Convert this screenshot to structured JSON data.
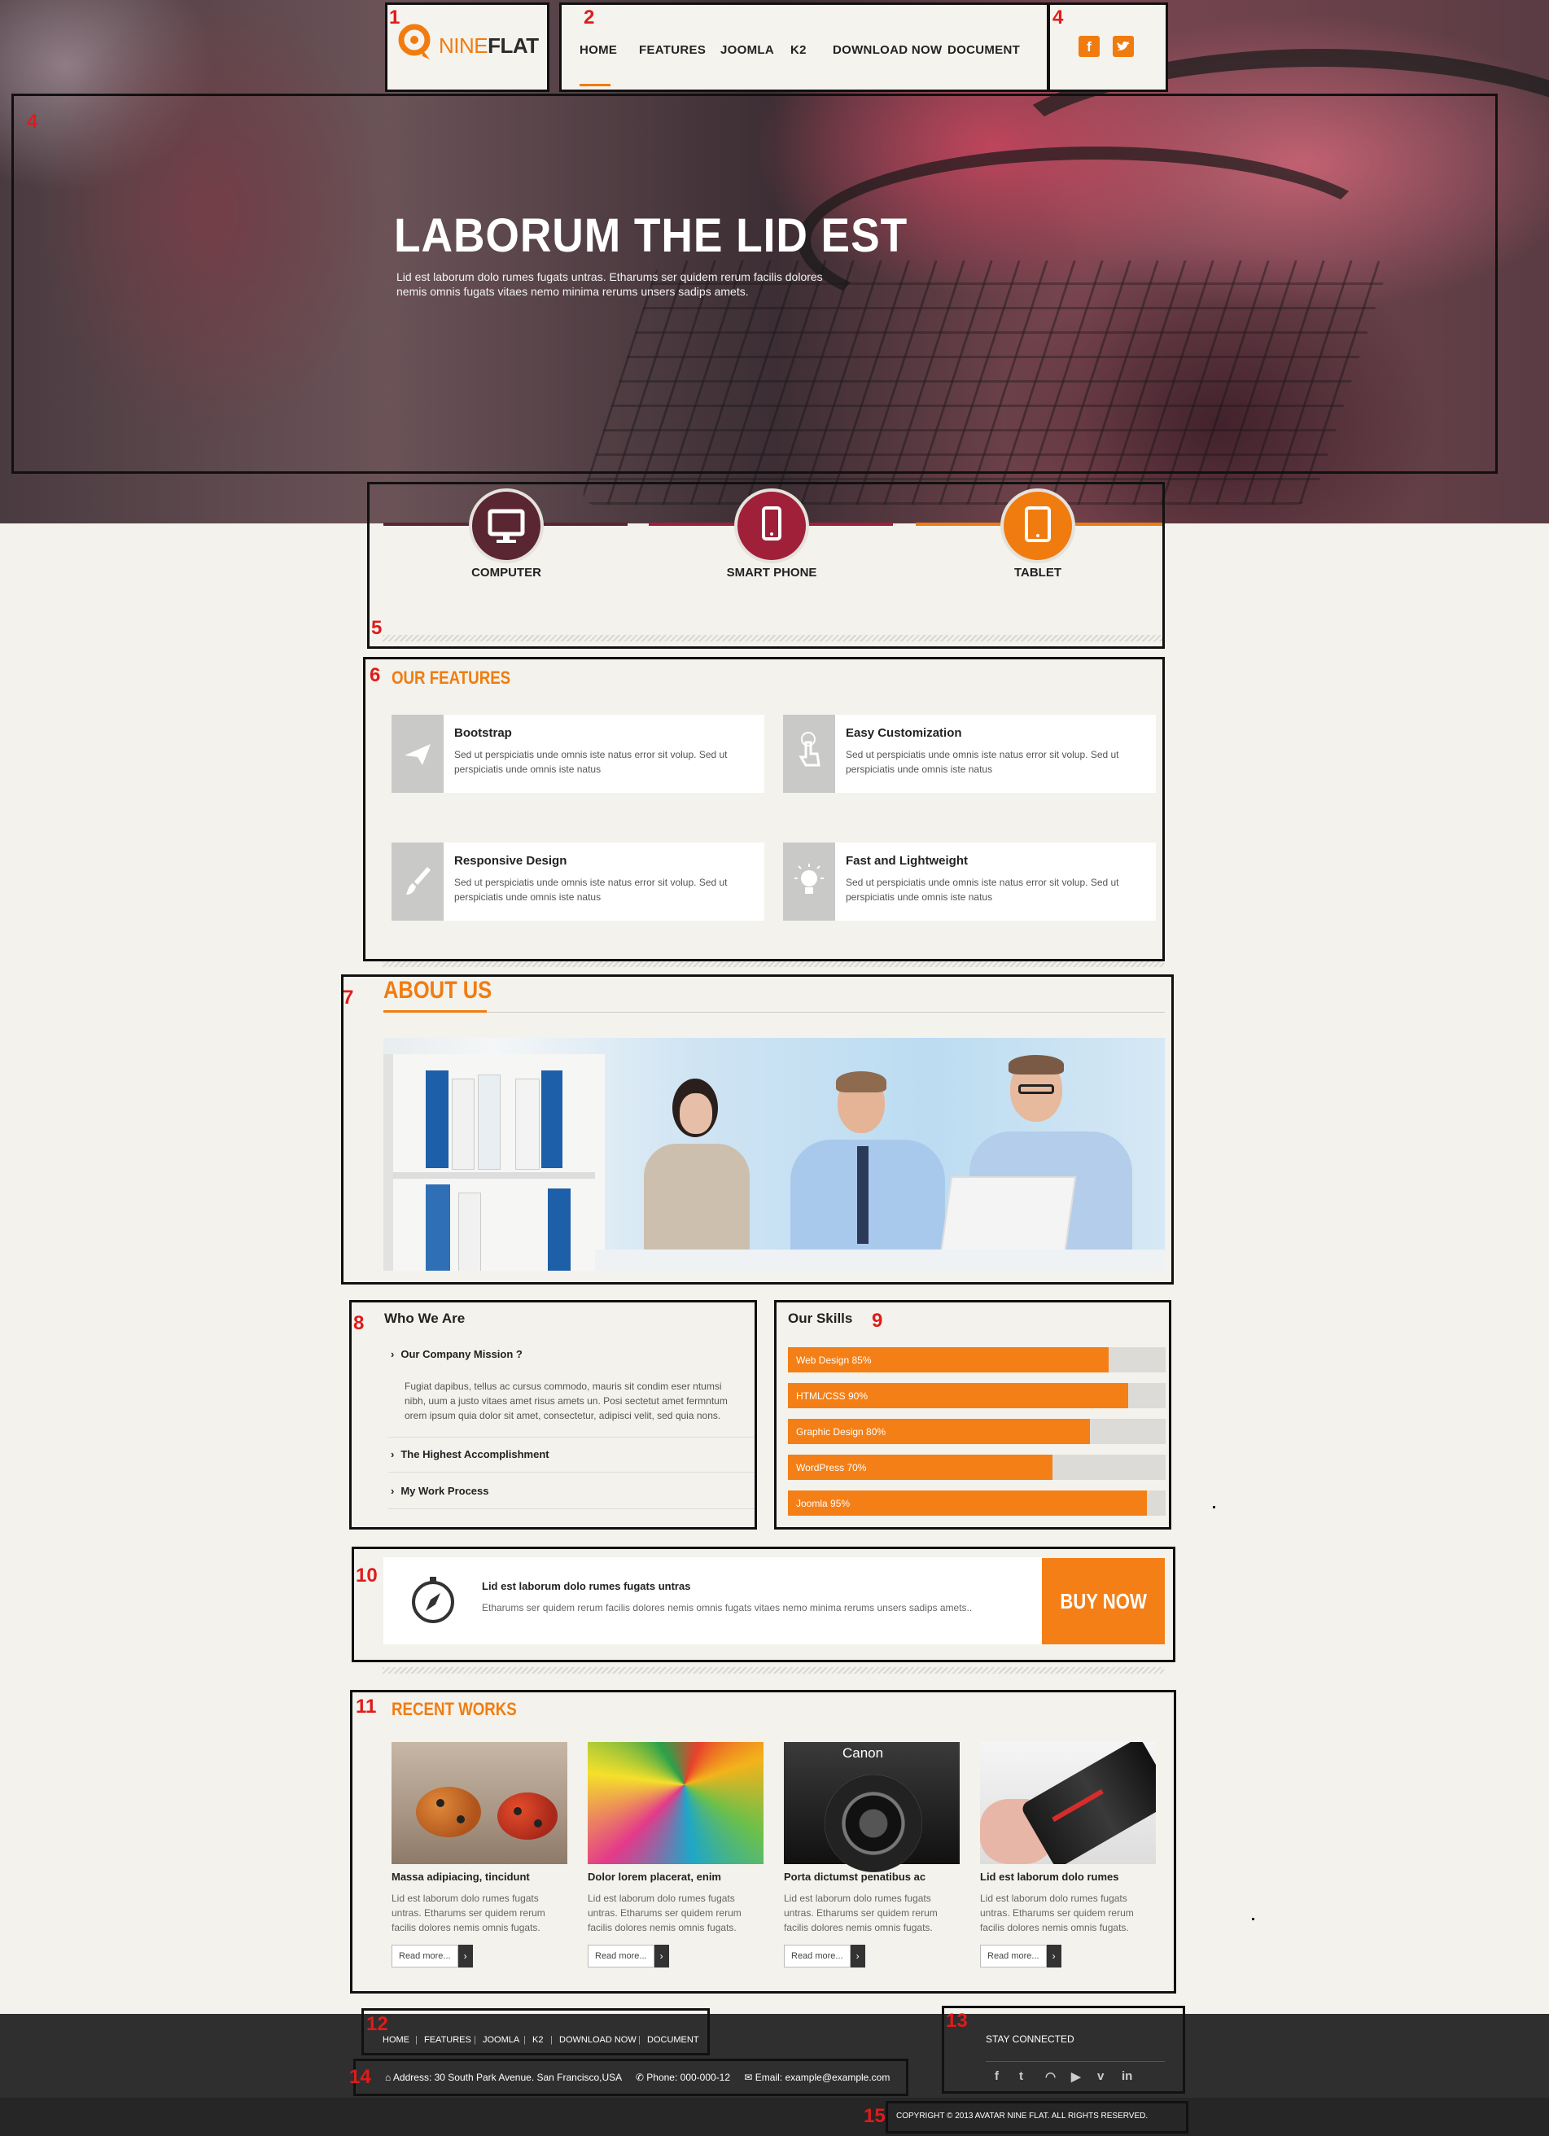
{
  "brand": {
    "logo_nine": "NINE",
    "logo_flat": "FLAT"
  },
  "nav": {
    "items": [
      "HOME",
      "FEATURES",
      "JOOMLA",
      "K2",
      "DOWNLOAD NOW",
      "DOCUMENT"
    ],
    "active": "HOME"
  },
  "social_top": {
    "facebook": "f",
    "twitter": "t"
  },
  "hero": {
    "title": "LABORUM THE LID EST",
    "text_line1": "Lid est laborum dolo rumes fugats untras. Etharums ser quidem rerum facilis dolores",
    "text_line2": "nemis omnis fugats vitaes nemo minima rerums unsers sadips amets."
  },
  "devices": [
    {
      "label": "COMPUTER",
      "icon": "monitor-icon",
      "color": "#5a2631"
    },
    {
      "label": "SMART PHONE",
      "icon": "smartphone-icon",
      "color": "#a0203a"
    },
    {
      "label": "TABLET",
      "icon": "tablet-icon",
      "color": "#f07c10"
    }
  ],
  "features": {
    "title": "OUR FEATURES",
    "items": [
      {
        "title": "Bootstrap",
        "icon": "paper-plane-icon",
        "line1": "Sed ut perspiciatis unde omnis iste natus error sit volup. Sed ut",
        "line2": "perspiciatis unde omnis iste natus"
      },
      {
        "title": "Easy Customization",
        "icon": "hand-pointer-icon",
        "line1": "Sed ut perspiciatis unde omnis iste natus error sit volup. Sed ut",
        "line2": "perspiciatis unde omnis iste natus"
      },
      {
        "title": "Responsive Design",
        "icon": "paint-brush-icon",
        "line1": "Sed ut perspiciatis unde omnis iste natus error sit volup. Sed ut",
        "line2": "perspiciatis unde omnis iste natus"
      },
      {
        "title": "Fast and Lightweight",
        "icon": "lightbulb-icon",
        "line1": "Sed ut perspiciatis unde omnis iste natus error sit volup. Sed ut",
        "line2": "perspiciatis unde omnis iste natus"
      }
    ]
  },
  "about": {
    "title": "ABOUT US"
  },
  "who": {
    "title": "Who We Are",
    "items": [
      {
        "label": "Our Company Mission ?",
        "expanded": true,
        "line1": "Fugiat dapibus, tellus ac cursus commodo, mauris sit condim eser ntumsi",
        "line2": "nibh, uum a justo vitaes amet risus amets un. Posi sectetut amet fermntum",
        "line3": "orem ipsum quia dolor sit amet, consectetur, adipisci velit, sed quia nons."
      },
      {
        "label": "The Highest Accomplishment",
        "expanded": false
      },
      {
        "label": "My Work Process",
        "expanded": false
      }
    ]
  },
  "skills": {
    "title": "Our Skills",
    "items": [
      {
        "label": "Web Design 85%",
        "value": 0.85
      },
      {
        "label": "HTML/CSS 90%",
        "value": 0.9
      },
      {
        "label": "Graphic Design 80%",
        "value": 0.8
      },
      {
        "label": "WordPress 70%",
        "value": 0.7
      },
      {
        "label": "Joomla 95%",
        "value": 0.95
      }
    ]
  },
  "cta": {
    "title": "Lid est laborum dolo rumes fugats untras",
    "text": "Etharums ser quidem rerum facilis dolores nemis omnis fugats vitaes nemo minima rerums unsers sadips amets..",
    "button": "BUY NOW"
  },
  "works": {
    "title": "RECENT WORKS",
    "items": [
      {
        "title": "Massa adipiacing, tincidunt",
        "line1": "Lid est laborum dolo rumes fugats",
        "line2": "untras. Etharums ser quidem rerum",
        "line3": "facilis dolores nemis omnis fugats.",
        "read": "Read more..."
      },
      {
        "title": "Dolor lorem placerat, enim",
        "line1": "Lid est laborum dolo rumes fugats",
        "line2": "untras. Etharums ser quidem rerum",
        "line3": "facilis dolores nemis omnis fugats.",
        "read": "Read more..."
      },
      {
        "title": "Porta dictumst penatibus ac",
        "line1": "Lid est laborum dolo rumes fugats",
        "line2": "untras. Etharums ser quidem rerum",
        "line3": "facilis dolores nemis omnis fugats.",
        "read": "Read more..."
      },
      {
        "title": "Lid est laborum dolo rumes",
        "line1": "Lid est laborum dolo rumes fugats",
        "line2": "untras. Etharums ser quidem rerum",
        "line3": "facilis dolores nemis omnis fugats.",
        "read": "Read more..."
      }
    ],
    "camera_brand": "Canon"
  },
  "footer": {
    "nav": [
      "HOME",
      "FEATURES",
      "JOOMLA",
      "K2",
      "DOWNLOAD NOW",
      "DOCUMENT"
    ],
    "stay_connected": "STAY CONNECTED",
    "social_icons": [
      "facebook-icon",
      "twitter-icon",
      "rss-icon",
      "youtube-icon",
      "vimeo-icon",
      "linkedin-icon"
    ],
    "address": "Address: 30 South Park Avenue. San Francisco,USA",
    "phone": "Phone: 000-000-12",
    "email": "Email: example@example.com",
    "copyright": "COPYRIGHT © 2013 AVATAR NINE FLAT. ALL RIGHTS RESERVED."
  },
  "annotations": [
    "1",
    "2",
    "4",
    "4",
    "5",
    "6",
    "7",
    "8",
    "9",
    "10",
    "11",
    "12",
    "13",
    "14",
    "15"
  ]
}
